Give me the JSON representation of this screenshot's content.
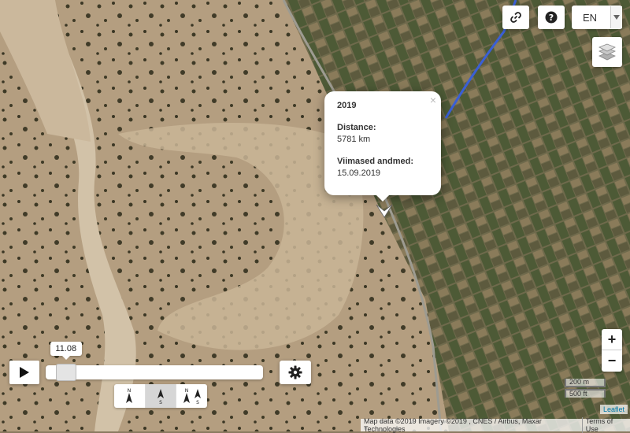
{
  "controls": {
    "link_icon": "link-icon",
    "help_icon": "question-circle-icon",
    "language": "EN",
    "layers_icon": "layers-icon"
  },
  "popup": {
    "title": "2019",
    "distance_label": "Distance:",
    "distance_value": "5781 km",
    "latest_label": "Viimased andmed:",
    "latest_value": "15.09.2019",
    "close": "×"
  },
  "zoom": {
    "in": "+",
    "out": "−"
  },
  "scale": {
    "metric": "200 m",
    "imperial": "500 ft"
  },
  "attribution": {
    "leaflet": "Leaflet",
    "text": "Map data ©2019 Imagery ©2019 , CNES / Airbus, Maxar Technologies",
    "terms": "Terms of Use"
  },
  "timeline": {
    "label": "11.08",
    "position": 0.04
  },
  "colors": {
    "track": "#3a5fd6",
    "marker": "#ffffff"
  }
}
